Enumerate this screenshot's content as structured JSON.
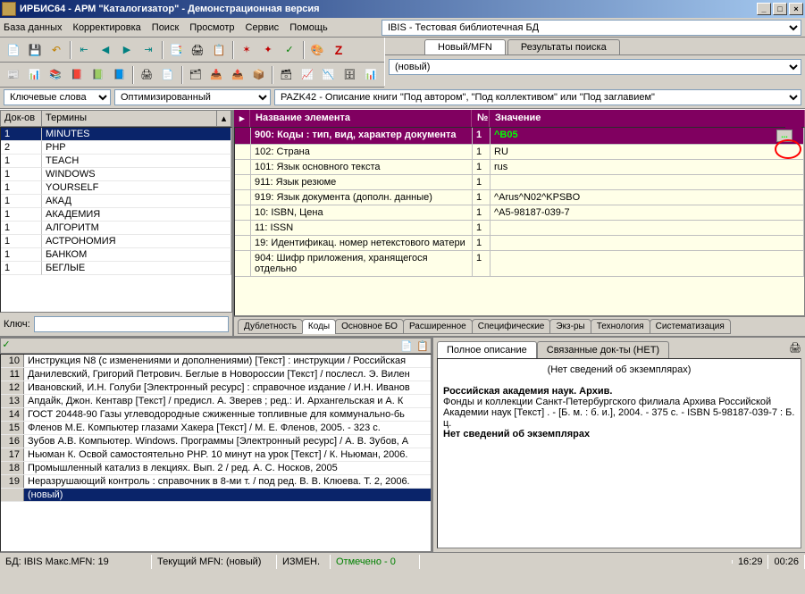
{
  "title": "ИРБИС64 - АРМ \"Каталогизатор\" - Демонстрационная версия",
  "menu": [
    "База данных",
    "Корректировка",
    "Поиск",
    "Просмотр",
    "Сервис",
    "Помощь"
  ],
  "db_selected": "IBIS - Тестовая библиотечная БД",
  "sub_tabs": {
    "new_mfn": "Новый/MFN",
    "results": "Результаты поиска"
  },
  "mfn_value": "(новый)",
  "row3": {
    "select1": "Ключевые слова",
    "select2": "Оптимизированный",
    "template": "PAZK42 - Описание книги \"Под автором\", \"Под коллективом\" или \"Под заглавием\""
  },
  "terms_header": {
    "c1": "Док-ов",
    "c2": "Термины"
  },
  "terms": [
    {
      "n": "1",
      "t": "MINUTES"
    },
    {
      "n": "2",
      "t": "PHP"
    },
    {
      "n": "1",
      "t": "TEACH"
    },
    {
      "n": "1",
      "t": "WINDOWS"
    },
    {
      "n": "1",
      "t": "YOURSELF"
    },
    {
      "n": "1",
      "t": "АКАД"
    },
    {
      "n": "1",
      "t": "АКАДЕМИЯ"
    },
    {
      "n": "1",
      "t": "АЛГОРИТМ"
    },
    {
      "n": "1",
      "t": "АСТРОНОМИЯ"
    },
    {
      "n": "1",
      "t": "БАНКОМ"
    },
    {
      "n": "1",
      "t": "БЕГЛЫЕ"
    }
  ],
  "key_label": "Ключ:",
  "elem_header": {
    "name": "Название элемента",
    "no": "№",
    "val": "Значение"
  },
  "elems": [
    {
      "name": "900: Коды : тип, вид, характер документа",
      "no": "1",
      "val": "^B05",
      "sel": true
    },
    {
      "name": "102: Страна",
      "no": "1",
      "val": "RU"
    },
    {
      "name": "101: Язык основного текста",
      "no": "1",
      "val": "rus"
    },
    {
      "name": "911: Язык резюме",
      "no": "1",
      "val": ""
    },
    {
      "name": "919: Язык документа (дополн. данные)",
      "no": "1",
      "val": "^Arus^N02^KPSBO"
    },
    {
      "name": "10: ISBN, Цена",
      "no": "1",
      "val": "^A5-98187-039-7"
    },
    {
      "name": "11: ISSN",
      "no": "1",
      "val": ""
    },
    {
      "name": "19: Идентификац. номер нетекстового матери",
      "no": "1",
      "val": ""
    },
    {
      "name": "904: Шифр приложения, хранящегося отдельно",
      "no": "1",
      "val": ""
    }
  ],
  "mid_tabs": [
    "Дублетность",
    "Коды",
    "Основное БО",
    "Расширенное",
    "Специфические",
    "Экз-ры",
    "Технология",
    "Систематизация"
  ],
  "mid_active": 1,
  "records": [
    {
      "n": "10",
      "t": "Инструкция N8   (с изменениями и дополнениями) [Текст] : инструкции / Российская"
    },
    {
      "n": "11",
      "t": "Данилевский, Григорий Петрович. Беглые в Новороссии [Текст] / послесл. Э. Вилен"
    },
    {
      "n": "12",
      "t": "Ивановский, И.Н. Голуби [Электронный ресурс] : справочное издание / И.Н. Иванов"
    },
    {
      "n": "13",
      "t": "Апдайк, Джон. Кентавр [Текст] / предисл. А. Зверев ; ред.: И. Архангельская и А. К"
    },
    {
      "n": "14",
      "t": "ГОСТ 20448-90 Газы углеводородные сжиженные топливные для коммунально-бь"
    },
    {
      "n": "15",
      "t": "Фленов М.Е. Компьютер глазами Хакера [Текст] / М. Е. Фленов, 2005. - 323 с."
    },
    {
      "n": "16",
      "t": "Зубов А.В. Компьютер. Windows. Программы [Электронный ресурс] / А. В. Зубов, А"
    },
    {
      "n": "17",
      "t": "Ньюман К. Освой самостоятельно PHP. 10 минут на урок [Текст] / К. Ньюман, 2006."
    },
    {
      "n": "18",
      "t": "Промышленный катализ в лекциях. Вып. 2 / ред. А. С. Носков, 2005"
    },
    {
      "n": "19",
      "t": "Неразрушающий контроль : справочник в 8-ми т. / под ред. В. В. Клюева. Т. 2, 2006."
    }
  ],
  "new_record_label": "(новый)",
  "desc_tabs": {
    "full": "Полное описание",
    "linked": "Связанные док-ты (НЕТ)"
  },
  "desc": {
    "no_copies": "(Нет сведений об экземплярах)",
    "heading": "Российская академия наук. Архив.",
    "body": "    Фонды и коллекции Санкт-Петербургского филиала Архива Российской Академии наук [Текст] . - [Б. м. : б. и.], 2004. - 375 с. - ISBN 5-98187-039-7 : Б. ц.",
    "no_copies2": "Нет сведений об экземплярах"
  },
  "status": {
    "s1": "БД: IBIS Макс.MFN: 19",
    "s2": "Текущий MFN: (новый)",
    "s3": "ИЗМЕН.",
    "s4": "Отмечено - 0",
    "s5": "16:29",
    "s6": "00:26"
  }
}
